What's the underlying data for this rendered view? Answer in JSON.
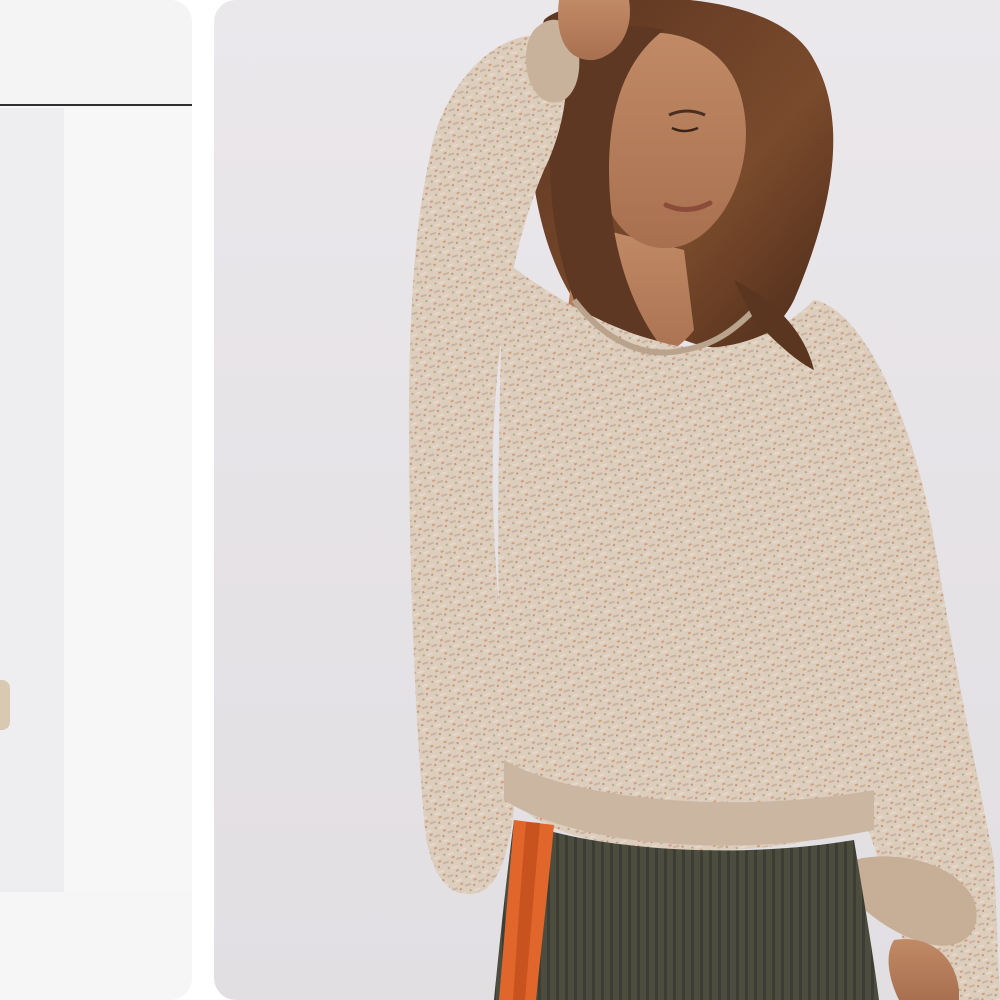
{
  "carousel": {
    "label": "",
    "cards": [
      {
        "id": "prev",
        "visible": "partial"
      },
      {
        "id": "current",
        "visible": "full"
      }
    ]
  },
  "colors": {
    "page_background": "#ffffff",
    "card_background": "#e8e5e9",
    "sweater": "#d9c8b6",
    "skirt": "#4e4f41",
    "stripe": "#e0662c",
    "hair": "#6b4128",
    "skin": "#b9805f"
  },
  "product": {
    "image_alt": "",
    "icon": "product-photo"
  }
}
